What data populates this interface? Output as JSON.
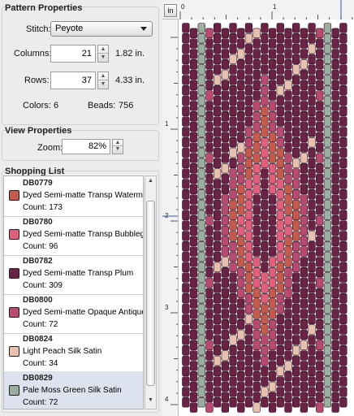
{
  "pattern_properties": {
    "title": "Pattern Properties",
    "stitch_label": "Stitch:",
    "stitch_value": "Peyote",
    "columns_label": "Columns:",
    "columns_value": "21",
    "columns_inches": "1.82 in.",
    "rows_label": "Rows:",
    "rows_value": "37",
    "rows_inches": "4.33 in.",
    "colors_label": "Colors:",
    "colors_value": "6",
    "beads_label": "Beads:",
    "beads_value": "756"
  },
  "view_properties": {
    "title": "View Properties",
    "zoom_label": "Zoom:",
    "zoom_value": "82%"
  },
  "shopping_list": {
    "title": "Shopping List",
    "items": [
      {
        "code": "DB0779",
        "name": "Dyed Semi-matte Transp Watermelon",
        "count": "Count: 173",
        "color": "#c45a4c"
      },
      {
        "code": "DB0780",
        "name": "Dyed Semi-matte Transp Bubblegum",
        "count": "Count: 96",
        "color": "#e0607c"
      },
      {
        "code": "DB0782",
        "name": "Dyed Semi-matte Transp Plum",
        "count": "Count: 309",
        "color": "#6a2344"
      },
      {
        "code": "DB0800",
        "name": "Dyed Semi-matte Opaque Antique Rose",
        "count": "Count: 72",
        "color": "#b84a70"
      },
      {
        "code": "DB0824",
        "name": "Light Peach Silk Satin",
        "count": "Count: 34",
        "color": "#e8c0b0"
      },
      {
        "code": "DB0829",
        "name": "Pale Moss Green Silk Satin",
        "count": "Count: 72",
        "color": "#9aaea0"
      }
    ]
  },
  "ruler": {
    "unit_button": "in",
    "h_labels": [
      "0",
      "1"
    ],
    "v_labels": [
      "1",
      "2",
      "3",
      "4"
    ]
  },
  "bead_colors": {
    "watermelon": "#c45a4c",
    "bubblegum": "#e0607c",
    "plum": "#6a2344",
    "rose": "#b84a70",
    "peach": "#e8c0b0",
    "moss": "#9aaea0"
  }
}
